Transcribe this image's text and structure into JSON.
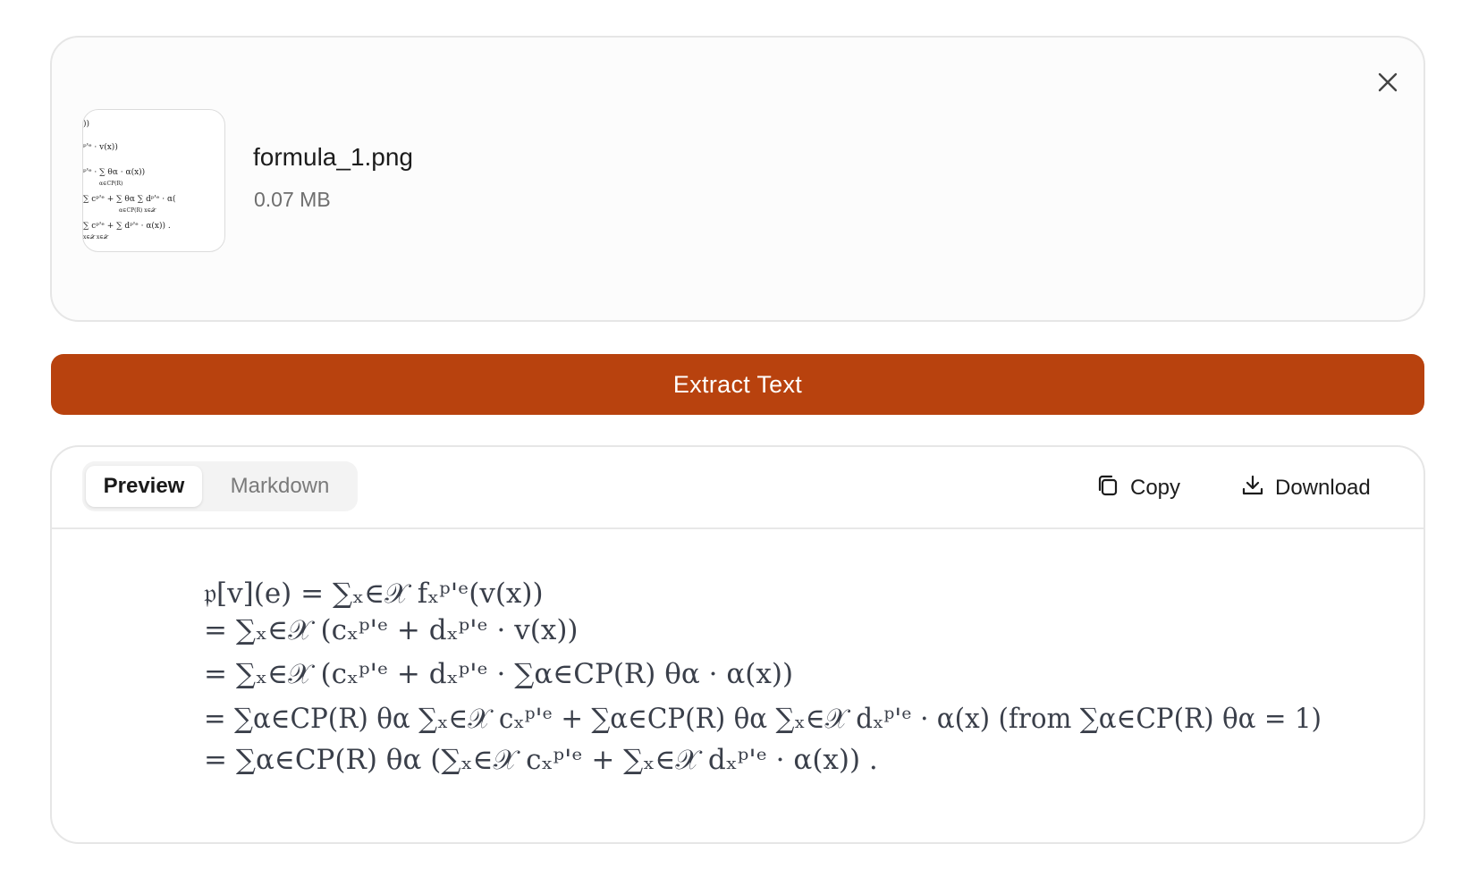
{
  "file": {
    "name": "formula_1.png",
    "size": "0.07 MB"
  },
  "icons": {
    "close": "close-icon",
    "copy": "copy-icon",
    "download": "download-icon"
  },
  "extract_button": {
    "label": "Extract Text",
    "color": "#b8420e"
  },
  "result": {
    "tabs": [
      {
        "label": "Preview",
        "active": true
      },
      {
        "label": "Markdown",
        "active": false
      }
    ],
    "actions": {
      "copy_label": "Copy",
      "download_label": "Download"
    },
    "formula_lines": [
      "𝔭[v](e) = ∑ₓ∈𝒳 fₓᵖ'ᵉ(v(x))",
      "= ∑ₓ∈𝒳 (cₓᵖ'ᵉ + dₓᵖ'ᵉ · v(x))",
      "= ∑ₓ∈𝒳 (cₓᵖ'ᵉ + dₓᵖ'ᵉ · ∑α∈CP(R) θα · α(x))",
      "= ∑α∈CP(R) θα ∑ₓ∈𝒳 cₓᵖ'ᵉ + ∑α∈CP(R) θα ∑ₓ∈𝒳 dₓᵖ'ᵉ · α(x)    (from ∑α∈CP(R) θα = 1)",
      "= ∑α∈CP(R) θα (∑ₓ∈𝒳 cₓᵖ'ᵉ + ∑ₓ∈𝒳 dₓᵖ'ᵉ · α(x)) ."
    ]
  }
}
